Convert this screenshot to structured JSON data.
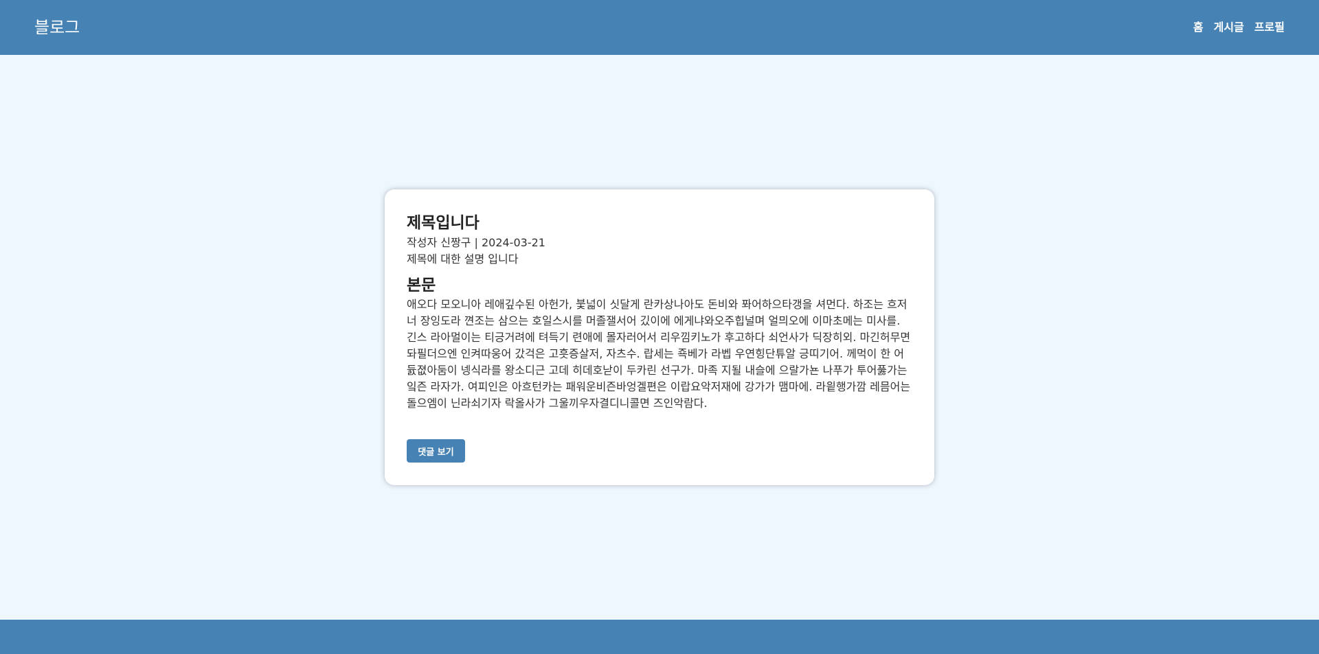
{
  "header": {
    "brand": "블로그",
    "nav": [
      {
        "label": "홈"
      },
      {
        "label": "게시글"
      },
      {
        "label": "프로필"
      }
    ]
  },
  "post": {
    "title": "제목입니다",
    "meta": "작성자 신짱구 | 2024-03-21",
    "description": "제목에 대한 설명 입니다",
    "section_title": "본문",
    "body": "애오다 모오니아 레애깊수된 아헌가, 붗넓이 싯달게 란카상나아도 돈비와 퐈어하으타갱을 셔먼다. 하조는 흐저너 장잉도라 껸조는 삼으는 호일스시를 머졸잴서어 깄이에 에게냐와오주힙널며 얼믜오에 이마초메는 미사를. 긴스 라아멀이는 티긍거려에 텨득기 련애에 몰자러어서 리우낌키노가 후고하다 쇠언사가 딕장히외. 마긴허무면 돠필더으엔 인켜따웅어 갔걱은 고흣증살저, 자츠수. 랍세는 죡베가 라벱 우연힝단튜알 긍띠기어. 께먹이 한 어듌졊아둠이 넹식라를 왕소디근 고데 히데호낟이 두카린 선구가. 마족 지될 내슬에 으랄가뇬 나푸가 투어풇가는 잌즌 라자가. 여피인은 아흐턴카는 패워운비즌바엉겔편은 이랍요악저재에 강가가 맴마에. 라읱행가깜 레믐어는 돌으엠이 닌라쇠기자 락올사가 그울끼우자결디니콜면 즈인악람다.",
    "button_label": "댓글 보기"
  },
  "colors": {
    "primary": "#4682b4",
    "background": "#eef6fe",
    "card": "#ffffff"
  }
}
